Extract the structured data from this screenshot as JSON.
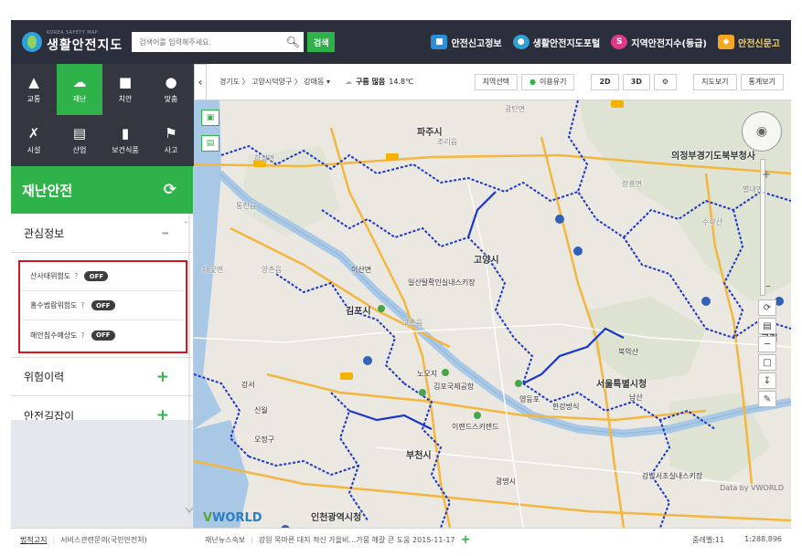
{
  "header": {
    "logo_sub": "KOREA SAFETY MAP",
    "logo_name": "생활안전지도",
    "search_placeholder": "검색어를 입력해주세요.",
    "search_button": "검색",
    "links": [
      {
        "label": "안전신고정보",
        "icon": "report-icon",
        "color": "#2a8ed8"
      },
      {
        "label": "생활안전지도포털",
        "icon": "portal-logo-icon",
        "color": "#2fa0d8"
      },
      {
        "label": "지역안전지수(등급)",
        "icon": "index-icon",
        "color": "#e2388b"
      },
      {
        "label": "안전신문고",
        "icon": "shield-icon",
        "color": "#f5a623"
      }
    ]
  },
  "categories": [
    {
      "label": "교통",
      "icon": "car-icon"
    },
    {
      "label": "재난",
      "icon": "cloud-rain-icon",
      "active": true
    },
    {
      "label": "치안",
      "icon": "police-icon"
    },
    {
      "label": "맞춤",
      "icon": "person-icon"
    },
    {
      "label": "시설",
      "icon": "tools-icon"
    },
    {
      "label": "산업",
      "icon": "factory-icon"
    },
    {
      "label": "보건식품",
      "icon": "bottle-icon"
    },
    {
      "label": "사고",
      "icon": "flag-icon"
    }
  ],
  "section": {
    "title": "재난안전"
  },
  "accordion": {
    "interest": "관심정보",
    "toggles": [
      {
        "label": "산사태위험도",
        "state": "OFF"
      },
      {
        "label": "홍수범람위험도",
        "state": "OFF"
      },
      {
        "label": "해안침수예상도",
        "state": "OFF"
      }
    ],
    "history": "위험이력",
    "route": "안전길잡이"
  },
  "topbar": {
    "location": "경기도 〉 고양시덕양구 〉 강매동 ▾",
    "weather": "구름 많음",
    "temperature": "14.8℃",
    "region_select": "지역선택",
    "guide": "이용유기",
    "mode_2d": "2D",
    "mode_3d": "3D",
    "map_view": "지도보기",
    "stats_view": "통계보기"
  },
  "map": {
    "labels": {
      "paju": "파주시",
      "uijeongbu": "의정부경기도북부청사",
      "goyang": "고양시",
      "ilsan": "일산탈확인실내스키장",
      "gimpo": "김포시",
      "seoul": "서울특별시청",
      "bucheon": "부천시",
      "incheon": "인천광역시청",
      "airport": "김포국제공항",
      "haseong": "하성면",
      "tongjin": "통진읍",
      "daegot": "대곶면",
      "yanggok": "양촌읍",
      "gochon": "고촌읍",
      "ilsanw": "이산면",
      "jangheung": "장흥면",
      "gangbuk": "북악산",
      "namsan": "남산",
      "guri": "구리",
      "yeongdeungpo": "영등포",
      "ochon": "오정구",
      "gwangmyeong": "광명시",
      "gangnam": "강남서초실내스키장",
      "leeland": "이랜드스키랜드",
      "gangseo": "강서",
      "nohe": "노오지",
      "sinwol": "신월",
      "jorigo": "조리읍",
      "gwanin": "광탄면",
      "hangang": "한강방식",
      "namyangju": "별내면",
      "suraksan": "수락산"
    },
    "vworld_v": "V",
    "vworld_text": "WORLD",
    "credit": "Data by VWORLD"
  },
  "footer": {
    "legal": "법적고지",
    "inquiry": "서비스관련문의(국민안전처)",
    "news_label": "재난뉴스속보",
    "news_text": "강원 목마른 대지 적신 가을비…가뭄 해갈 큰 도움 2015-11-17",
    "zoom_level": "줌레벨:11",
    "scale": "1:288,896"
  },
  "colors": {
    "accent": "#2fb24a",
    "header_bg": "#2b2f3c",
    "category_bg": "#34373f",
    "highlight": "#d6161e",
    "boundary": "#1a36c8"
  }
}
